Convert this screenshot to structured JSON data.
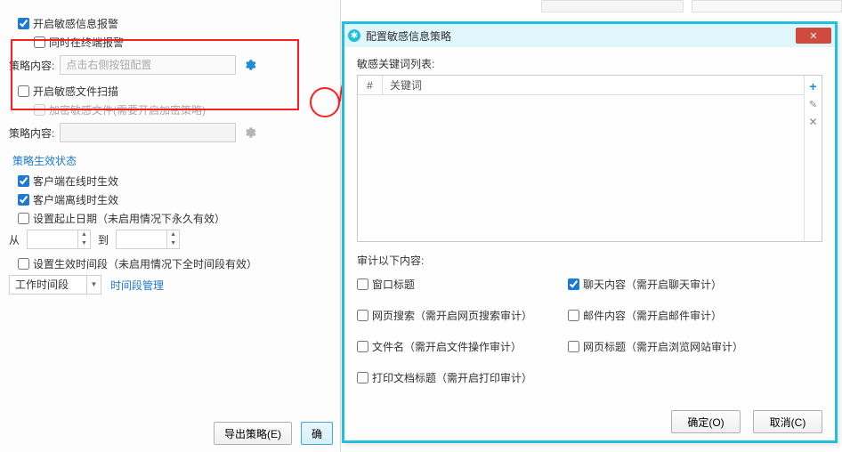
{
  "left": {
    "cb_open_alert": {
      "label": "开启敏感信息报警",
      "checked": true
    },
    "cb_terminal_alert": {
      "label": "同时在终端报警",
      "checked": false
    },
    "policy_content_label": "策略内容:",
    "policy_content_placeholder": "点击右侧按钮配置",
    "cb_open_scan": {
      "label": "开启敏感文件扫描",
      "checked": false
    },
    "cb_encrypt_files": {
      "label": "加密敏感文件(需要开启加密策略)",
      "checked": false
    },
    "policy_content_label2": "策略内容:",
    "section_title": "策略生效状态",
    "cb_online": {
      "label": "客户端在线时生效",
      "checked": true
    },
    "cb_offline": {
      "label": "客户端离线时生效",
      "checked": true
    },
    "cb_set_start": {
      "label": "设置起止日期（未启用情况下永久有效）",
      "checked": false
    },
    "from_label": "从",
    "to_label": "到",
    "cb_set_period": {
      "label": "设置生效时间段（未启用情况下全时间段有效）",
      "checked": false
    },
    "worktime_label": "工作时间段",
    "time_mgmt_link": "时间段管理",
    "btn_export": "导出策略(E)",
    "btn_ok_cut": "确"
  },
  "dialog": {
    "title": "配置敏感信息策略",
    "kw_list_label": "敏感关键词列表:",
    "kw_col_idx": "#",
    "kw_col_name": "关键词",
    "side": {
      "plus": "+",
      "pen": "✎",
      "del": "✕"
    },
    "audit_label": "审计以下内容:",
    "cb_window_title": {
      "label": "窗口标题",
      "checked": false
    },
    "cb_web_search": {
      "label": "网页搜索（需开启网页搜索审计）",
      "checked": false
    },
    "cb_filename": {
      "label": "文件名（需开启文件操作审计）",
      "checked": false
    },
    "cb_print_title": {
      "label": "打印文档标题（需开启打印审计）",
      "checked": false
    },
    "cb_chat": {
      "label": "聊天内容（需开启聊天审计）",
      "checked": true
    },
    "cb_mail": {
      "label": "邮件内容（需开启邮件审计）",
      "checked": false
    },
    "cb_web_title": {
      "label": "网页标题（需开启浏览网站审计）",
      "checked": false
    },
    "btn_ok": "确定(O)",
    "btn_cancel": "取消(C)"
  }
}
